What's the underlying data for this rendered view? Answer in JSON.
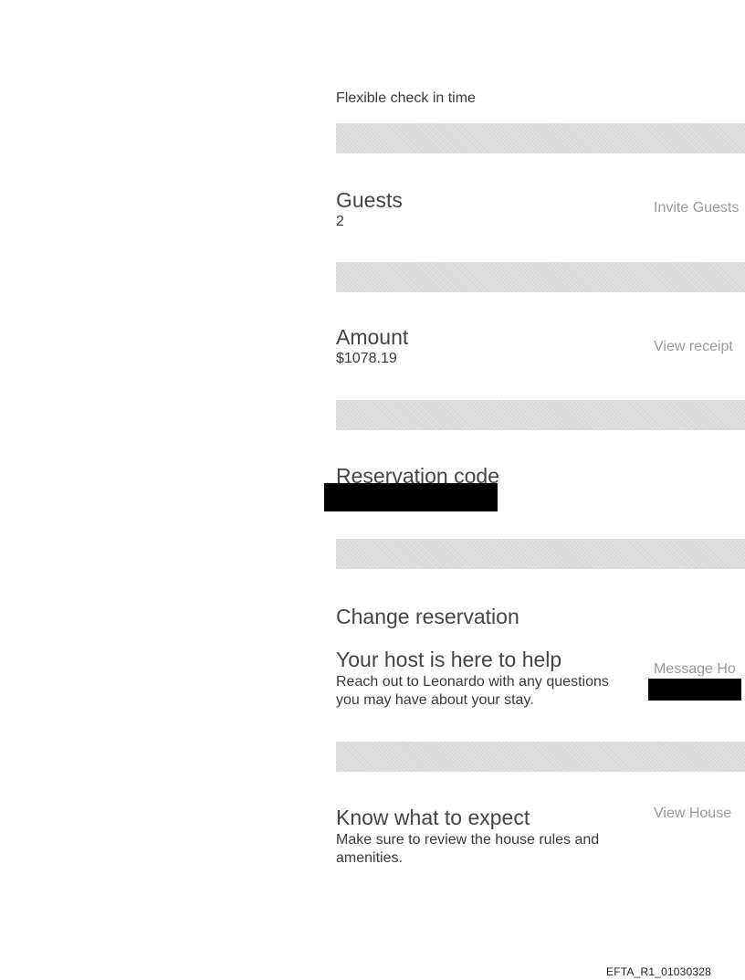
{
  "checkin": {
    "text": "Flexible check in time"
  },
  "guests": {
    "heading": "Guests",
    "value": "2",
    "link": "Invite Guests"
  },
  "amount": {
    "heading": "Amount",
    "value": "$1078.19",
    "link": "View receipt"
  },
  "reservation": {
    "heading": "Reservation code"
  },
  "change": {
    "heading": "Change reservation"
  },
  "host": {
    "heading": "Your host is here to help",
    "desc_line1": "Reach out to Leonardo with any questions",
    "desc_line2": "you may have about your stay.",
    "link": "Message Ho"
  },
  "expect": {
    "heading": "Know what to expect",
    "desc_line1": "Make sure to review the house rules and",
    "desc_line2": "amenities.",
    "link": "View House"
  },
  "footer": {
    "code": "EFTA_R1_01030328"
  }
}
